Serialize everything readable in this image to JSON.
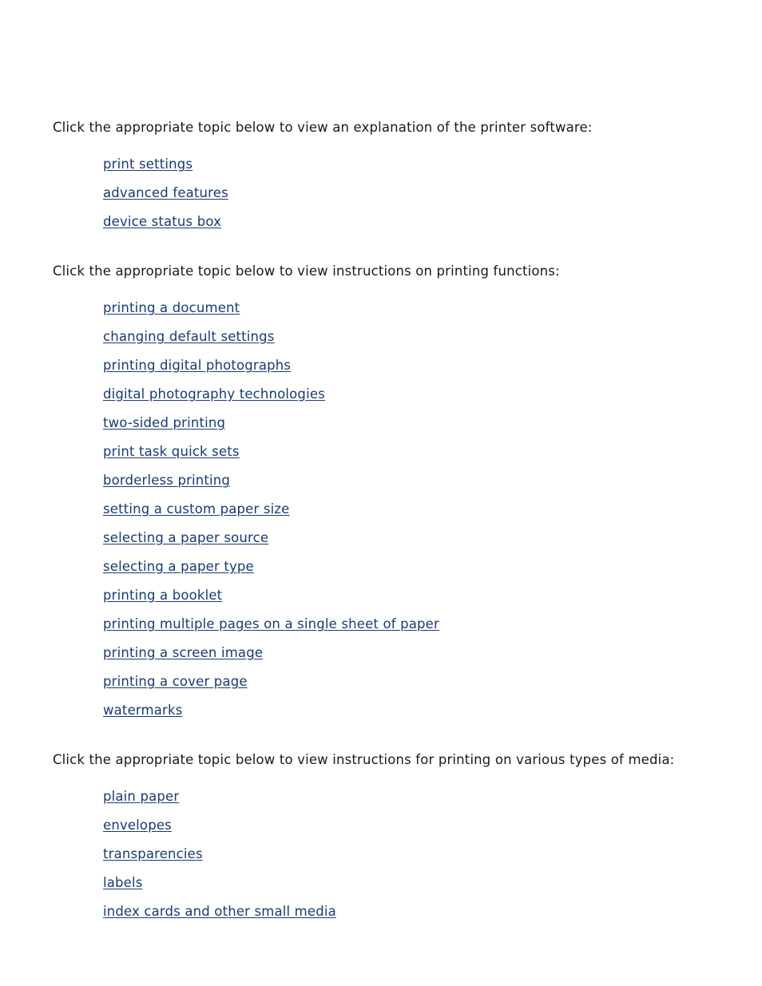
{
  "document": {
    "type": "printer-software-help-topic-index",
    "background_color": "#ffffff",
    "body_text_color": "#1a1a1a",
    "link_color": "#1a3a72"
  },
  "sections": [
    {
      "lead": "Click the appropriate topic below to view an explanation of the printer software:",
      "links": [
        "print settings",
        "advanced features",
        "device status box"
      ]
    },
    {
      "lead": "Click the appropriate topic below to view instructions on printing functions:",
      "links": [
        "printing a document",
        "changing default settings",
        "printing digital photographs",
        "digital photography technologies",
        "two-sided printing",
        "print task quick sets",
        "borderless printing",
        "setting a custom paper size",
        "selecting a paper source",
        "selecting a paper type",
        "printing a booklet",
        "printing multiple pages on a single sheet of paper",
        "printing a screen image",
        "printing a cover page",
        "watermarks"
      ]
    },
    {
      "lead": "Click the appropriate topic below to view instructions for printing on various types of media:",
      "links": [
        "plain paper",
        "envelopes",
        "transparencies",
        "labels",
        "index cards and other small media"
      ]
    }
  ]
}
